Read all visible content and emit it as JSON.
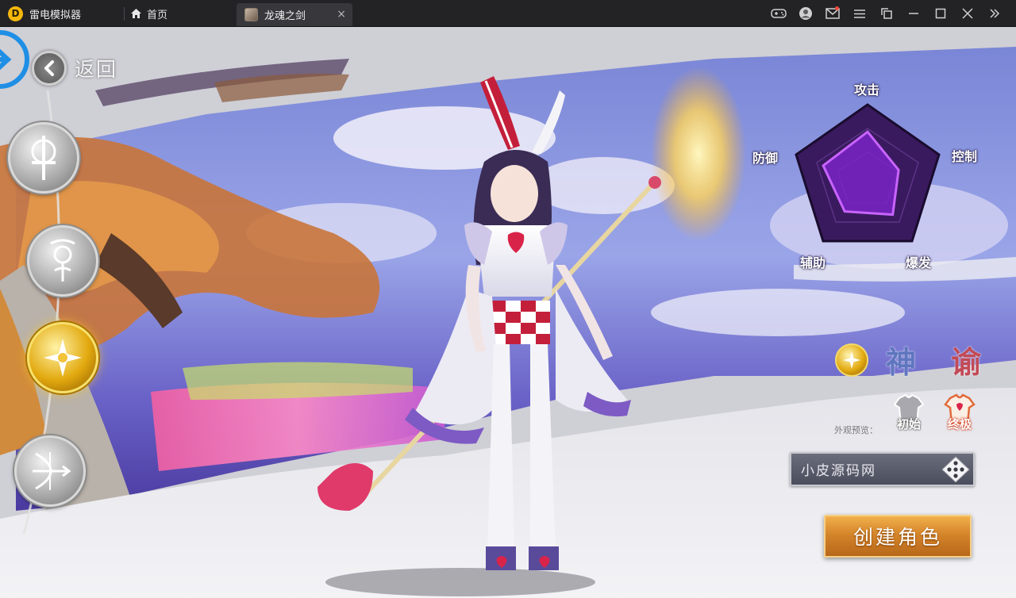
{
  "emulator": {
    "brand_name": "雷电模拟器",
    "home_tab_label": "首页",
    "game_tab_label": "龙魂之剑",
    "game_tab_close": "×"
  },
  "window_controls": [
    "gamepad-icon",
    "account-icon",
    "mail-icon",
    "menu-icon",
    "screenshot-icon",
    "minimize-icon",
    "maximize-icon",
    "close-icon",
    "collapse-sidebar-icon"
  ],
  "game": {
    "back_label": "返回",
    "class_buttons": [
      {
        "name": "sword-class",
        "selected": false
      },
      {
        "name": "rose-class",
        "selected": false
      },
      {
        "name": "cross-class",
        "selected": true
      },
      {
        "name": "bow-class",
        "selected": false
      }
    ],
    "radar": {
      "labels": {
        "attack": "攻击",
        "control": "控制",
        "burst": "爆发",
        "support": "辅助",
        "defense": "防御"
      },
      "values": {
        "attack": 0.62,
        "control": 0.42,
        "burst": 0.55,
        "support": 0.5,
        "defense": 0.6
      }
    },
    "class_name": [
      "神",
      "谕"
    ],
    "appearance": {
      "label": "外观预览：",
      "options": [
        {
          "label": "初始",
          "selected": false
        },
        {
          "label": "终极",
          "selected": true
        }
      ]
    },
    "name_input": {
      "value": "小皮源码网"
    },
    "create_label": "创建角色",
    "colors": {
      "radar_fill": "#3a1a5e",
      "radar_inner": "#8a2ad8",
      "gold": "#e2a90f",
      "create": "#d4852a"
    }
  }
}
